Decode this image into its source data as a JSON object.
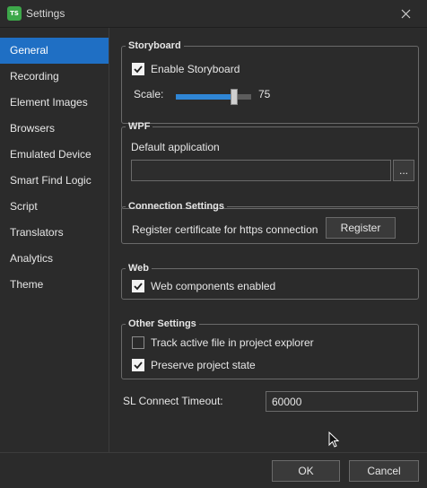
{
  "window": {
    "title": "Settings",
    "icon_text": "TS",
    "close_glyph": "✕"
  },
  "sidebar": {
    "items": [
      {
        "label": "General",
        "active": true
      },
      {
        "label": "Recording"
      },
      {
        "label": "Element Images"
      },
      {
        "label": "Browsers"
      },
      {
        "label": "Emulated Device"
      },
      {
        "label": "Smart Find Logic"
      },
      {
        "label": "Script"
      },
      {
        "label": "Translators"
      },
      {
        "label": "Analytics"
      },
      {
        "label": "Theme"
      }
    ]
  },
  "storyboard": {
    "legend": "Storyboard",
    "enable_label": "Enable Storyboard",
    "enable_checked": true,
    "scale_label": "Scale:",
    "scale_value": "75",
    "scale_fraction": 0.75
  },
  "wpf": {
    "legend": "WPF",
    "default_app_label": "Default application",
    "default_app_value": "",
    "browse_label": "..."
  },
  "connection": {
    "legend": "Connection Settings",
    "register_text": "Register certificate for https connection",
    "register_button": "Register"
  },
  "web": {
    "legend": "Web",
    "components_label": "Web components enabled",
    "components_checked": true
  },
  "other": {
    "legend": "Other Settings",
    "track_label": "Track active file in project explorer",
    "track_checked": false,
    "preserve_label": "Preserve project state",
    "preserve_checked": true
  },
  "timeout": {
    "label": "SL Connect Timeout:",
    "value": "60000"
  },
  "footer": {
    "ok_label": "OK",
    "cancel_label": "Cancel"
  },
  "colors": {
    "accent": "#1f6fc4",
    "slider_fill": "#2f86d6",
    "background": "#2b2b2b",
    "icon_green": "#3da84a"
  }
}
